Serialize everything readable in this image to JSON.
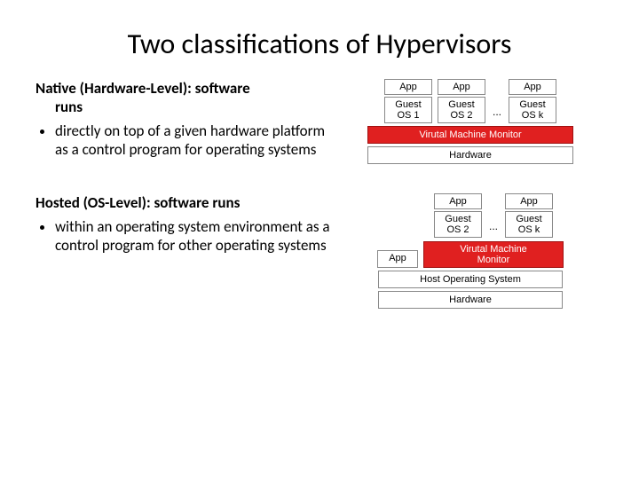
{
  "title": "Two classifications of Hypervisors",
  "native": {
    "heading_line1": "Native (Hardware-Level): software",
    "heading_line2": "runs",
    "bullet": "directly on top of a given hardware platform as a control program for operating systems",
    "diagram": {
      "app": "App",
      "guest1": "Guest OS 1",
      "guest2": "Guest OS 2",
      "guestk": "Guest OS k",
      "dots": "...",
      "vmm": "Virutal Machine Monitor",
      "hardware": "Hardware"
    }
  },
  "hosted": {
    "heading": "Hosted (OS-Level): software runs",
    "bullet": "within an operating system environment as a control program for other operating systems",
    "diagram": {
      "app": "App",
      "guest2": "Guest OS 2",
      "guestk": "Guest OS k",
      "dots": "...",
      "vmm_l1": "Virutal Machine",
      "vmm_l2": "Monitor",
      "host_os": "Host Operating System",
      "hardware": "Hardware"
    }
  }
}
